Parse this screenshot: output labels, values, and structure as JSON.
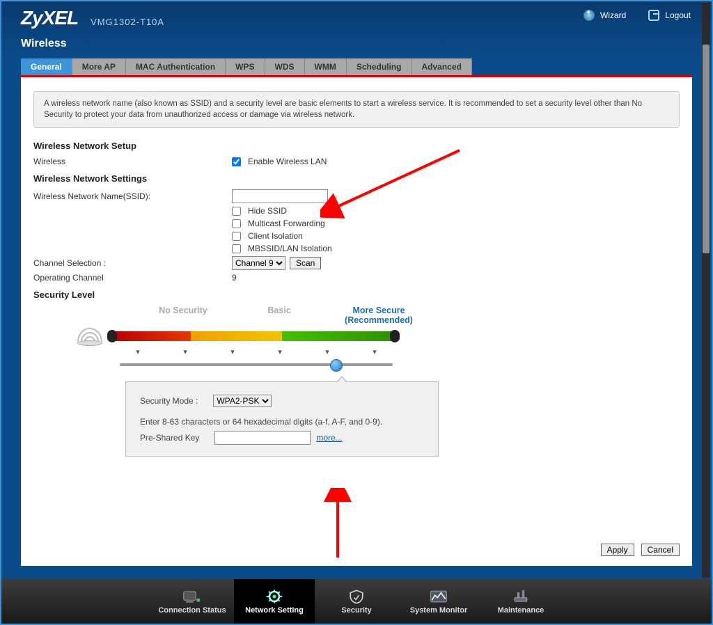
{
  "header": {
    "logo": "ZyXEL",
    "model": "VMG1302-T10A",
    "wizard": "Wizard",
    "logout": "Logout",
    "page_title": "Wireless"
  },
  "tabs": [
    "General",
    "More AP",
    "MAC Authentication",
    "WPS",
    "WDS",
    "WMM",
    "Scheduling",
    "Advanced"
  ],
  "active_tab_index": 0,
  "info_text": "A wireless network name (also known as SSID) and a security level are basic elements to start a wireless service. It is recommended to set a security level other than No Security to protect your data from unauthorized access or damage via wireless network.",
  "sections": {
    "setup_title": "Wireless Network Setup",
    "settings_title": "Wireless Network Settings",
    "security_title": "Security Level"
  },
  "fields": {
    "wireless_label": "Wireless",
    "enable_lan_label": "Enable Wireless LAN",
    "enable_lan_checked": true,
    "ssid_label": "Wireless Network Name(SSID):",
    "ssid_value": "",
    "hide_ssid_label": "Hide SSID",
    "multicast_label": "Multicast Forwarding",
    "client_iso_label": "Client Isolation",
    "mbssid_label": "MBSSID/LAN Isolation",
    "channel_label": "Channel Selection :",
    "channel_value": "Channel 9",
    "scan_btn": "Scan",
    "operating_label": "Operating Channel",
    "operating_value": "9"
  },
  "security": {
    "no_security": "No Security",
    "basic": "Basic",
    "more_secure_line1": "More Secure",
    "more_secure_line2": "(Recommended)",
    "mode_label": "Security Mode :",
    "mode_value": "WPA2-PSK",
    "hint": "Enter 8-63 characters or 64 hexadecimal digits (a-f, A-F, and 0-9).",
    "psk_label": "Pre-Shared Key",
    "psk_value": "",
    "more_link": "more..."
  },
  "buttons": {
    "apply": "Apply",
    "cancel": "Cancel"
  },
  "bottom_nav": [
    {
      "id": "connection-status",
      "label": "Connection Status"
    },
    {
      "id": "network-setting",
      "label": "Network Setting"
    },
    {
      "id": "security",
      "label": "Security"
    },
    {
      "id": "system-monitor",
      "label": "System Monitor"
    },
    {
      "id": "maintenance",
      "label": "Maintenance"
    }
  ],
  "active_nav_index": 1
}
